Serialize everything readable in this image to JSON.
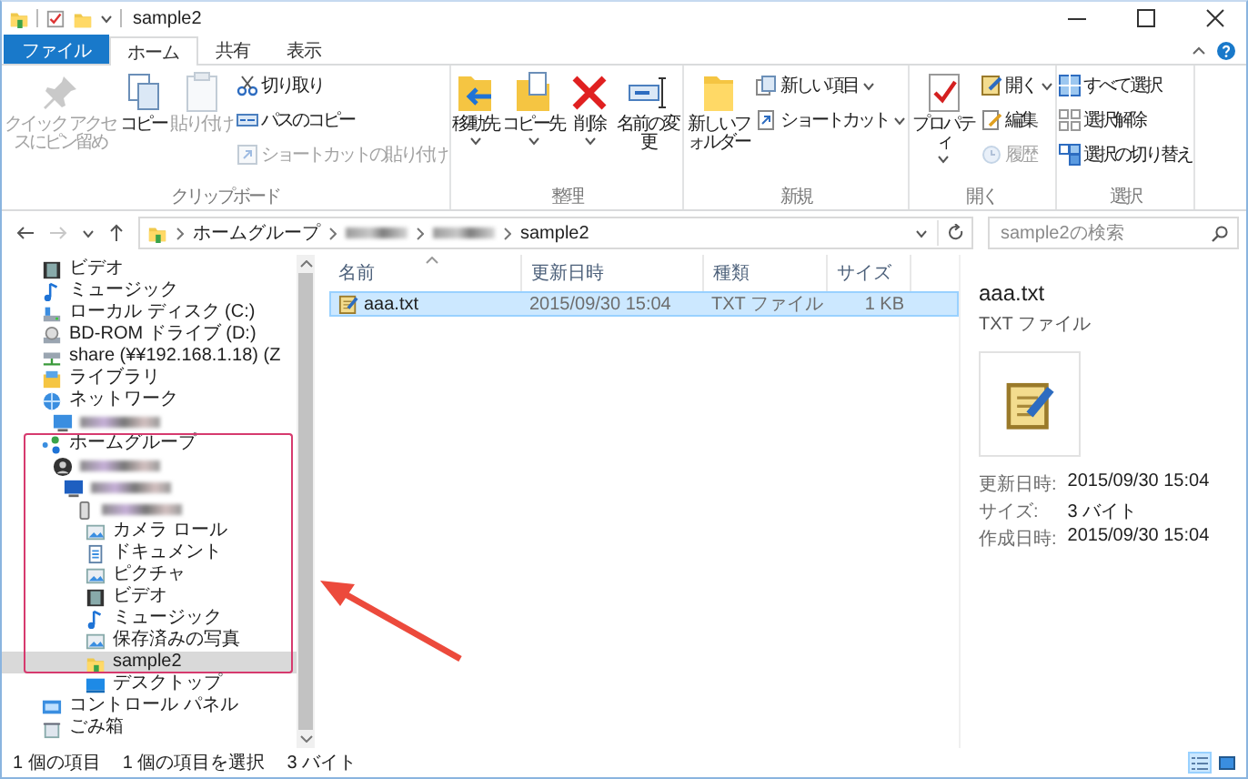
{
  "window": {
    "title": "sample2"
  },
  "tabs": [
    {
      "label": "ファイル",
      "kind": "file",
      "selected": false
    },
    {
      "label": "ホーム",
      "kind": "tab",
      "selected": true
    },
    {
      "label": "共有",
      "kind": "tab",
      "selected": false
    },
    {
      "label": "表示",
      "kind": "tab",
      "selected": false
    }
  ],
  "ribbon": {
    "groups": [
      {
        "label": "クリップボード",
        "items": [
          {
            "kind": "large",
            "label": "クイック アクセスにピン留め",
            "disabled": true,
            "dropdown": false
          },
          {
            "kind": "large",
            "label": "コピー",
            "disabled": false,
            "dropdown": false
          },
          {
            "kind": "large",
            "label": "貼り付け",
            "disabled": true,
            "dropdown": false
          },
          {
            "kind": "small",
            "label": "切り取り",
            "disabled": false,
            "dropdown": false
          },
          {
            "kind": "small",
            "label": "パスのコピー",
            "disabled": false,
            "dropdown": false
          },
          {
            "kind": "small",
            "label": "ショートカットの貼り付け",
            "disabled": true,
            "dropdown": false
          }
        ]
      },
      {
        "label": "整理",
        "items": [
          {
            "kind": "large",
            "label": "移動先",
            "disabled": false,
            "dropdown": true
          },
          {
            "kind": "large",
            "label": "コピー先",
            "disabled": false,
            "dropdown": true
          },
          {
            "kind": "large",
            "label": "削除",
            "disabled": false,
            "dropdown": true
          },
          {
            "kind": "large",
            "label": "名前の変更",
            "disabled": false,
            "dropdown": false
          }
        ]
      },
      {
        "label": "新規",
        "items": [
          {
            "kind": "large",
            "label": "新しいフォルダー",
            "disabled": false,
            "dropdown": false
          },
          {
            "kind": "small",
            "label": "新しい項目",
            "disabled": false,
            "dropdown": true
          },
          {
            "kind": "small",
            "label": "ショートカット",
            "disabled": false,
            "dropdown": true
          }
        ]
      },
      {
        "label": "開く",
        "items": [
          {
            "kind": "large",
            "label": "プロパティ",
            "disabled": false,
            "dropdown": true
          },
          {
            "kind": "small",
            "label": "開く",
            "disabled": false,
            "dropdown": true
          },
          {
            "kind": "small",
            "label": "編集",
            "disabled": false,
            "dropdown": false
          },
          {
            "kind": "small",
            "label": "履歴",
            "disabled": true,
            "dropdown": false
          }
        ]
      },
      {
        "label": "選択",
        "items": [
          {
            "kind": "small",
            "label": "すべて選択",
            "disabled": false,
            "dropdown": false
          },
          {
            "kind": "small",
            "label": "選択解除",
            "disabled": false,
            "dropdown": false
          },
          {
            "kind": "small",
            "label": "選択の切り替え",
            "disabled": false,
            "dropdown": false
          }
        ]
      }
    ]
  },
  "address_bar": {
    "path": [
      {
        "kind": "text",
        "label": "ホームグループ"
      },
      {
        "kind": "blurred"
      },
      {
        "kind": "blurred"
      },
      {
        "kind": "text",
        "label": "sample2"
      }
    ]
  },
  "search": {
    "placeholder": "sample2の検索"
  },
  "sidebar": {
    "items": [
      {
        "kind": "text",
        "label": "ビデオ",
        "selected": false,
        "highlighted": false
      },
      {
        "kind": "text",
        "label": "ミュージック",
        "selected": false,
        "highlighted": false
      },
      {
        "kind": "text",
        "label": "ローカル ディスク (C:)",
        "selected": false,
        "highlighted": false
      },
      {
        "kind": "text",
        "label": "BD-ROM ドライブ (D:)",
        "selected": false,
        "highlighted": false
      },
      {
        "kind": "text",
        "label": "share (¥¥192.168.1.18) (Z",
        "selected": false,
        "highlighted": false
      },
      {
        "kind": "text",
        "label": "ライブラリ",
        "selected": false,
        "highlighted": false
      },
      {
        "kind": "text",
        "label": "ネットワーク",
        "selected": false,
        "highlighted": false,
        "children": [
          {
            "kind": "blurred",
            "selected": false,
            "highlighted": false
          }
        ]
      },
      {
        "kind": "text",
        "label": "ホームグループ",
        "selected": false,
        "highlighted": true,
        "children": [
          {
            "kind": "blurred",
            "selected": false,
            "highlighted": true,
            "children": [
              {
                "kind": "blurred",
                "selected": false,
                "highlighted": true,
                "children": [
                  {
                    "kind": "blurred",
                    "selected": false,
                    "highlighted": true,
                    "children": [
                      {
                        "kind": "text",
                        "label": "カメラ ロール",
                        "selected": false,
                        "highlighted": true
                      },
                      {
                        "kind": "text",
                        "label": "ドキュメント",
                        "selected": false,
                        "highlighted": true
                      },
                      {
                        "kind": "text",
                        "label": "ピクチャ",
                        "selected": false,
                        "highlighted": true
                      },
                      {
                        "kind": "text",
                        "label": "ビデオ",
                        "selected": false,
                        "highlighted": true
                      },
                      {
                        "kind": "text",
                        "label": "ミュージック",
                        "selected": false,
                        "highlighted": true
                      },
                      {
                        "kind": "text",
                        "label": "保存済みの写真",
                        "selected": false,
                        "highlighted": true
                      },
                      {
                        "kind": "text",
                        "label": "sample2",
                        "selected": true,
                        "highlighted": true
                      },
                      {
                        "kind": "text",
                        "label": "デスクトップ",
                        "selected": false,
                        "highlighted": false
                      }
                    ]
                  }
                ]
              }
            ]
          }
        ]
      },
      {
        "kind": "text",
        "label": "コントロール パネル",
        "selected": false,
        "highlighted": false
      },
      {
        "kind": "text",
        "label": "ごみ箱",
        "selected": false,
        "highlighted": false
      }
    ]
  },
  "file_list": {
    "columns": [
      {
        "label": "名前",
        "sort_indicator": true
      },
      {
        "label": "更新日時",
        "sort_indicator": false
      },
      {
        "label": "種類",
        "sort_indicator": false
      },
      {
        "label": "サイズ",
        "sort_indicator": false
      }
    ],
    "rows": [
      {
        "cells": [
          "aaa.txt",
          "2015/09/30 15:04",
          "TXT ファイル",
          "1 KB"
        ],
        "selected": true
      }
    ]
  },
  "annotation_arrow": true,
  "preview": {
    "title": "aaa.txt",
    "type": "TXT ファイル",
    "details": [
      {
        "label": "更新日時:",
        "value": "2015/09/30 15:04"
      },
      {
        "label": "サイズ:",
        "value": "3 バイト"
      },
      {
        "label": "作成日時:",
        "value": "2015/09/30 15:04"
      }
    ]
  },
  "status_bar": {
    "texts": [
      "1 個の項目",
      "1 個の項目を選択",
      "3 バイト"
    ],
    "views": [
      {
        "kind": "details",
        "selected": true
      },
      {
        "kind": "large_icons",
        "selected": false
      }
    ]
  }
}
